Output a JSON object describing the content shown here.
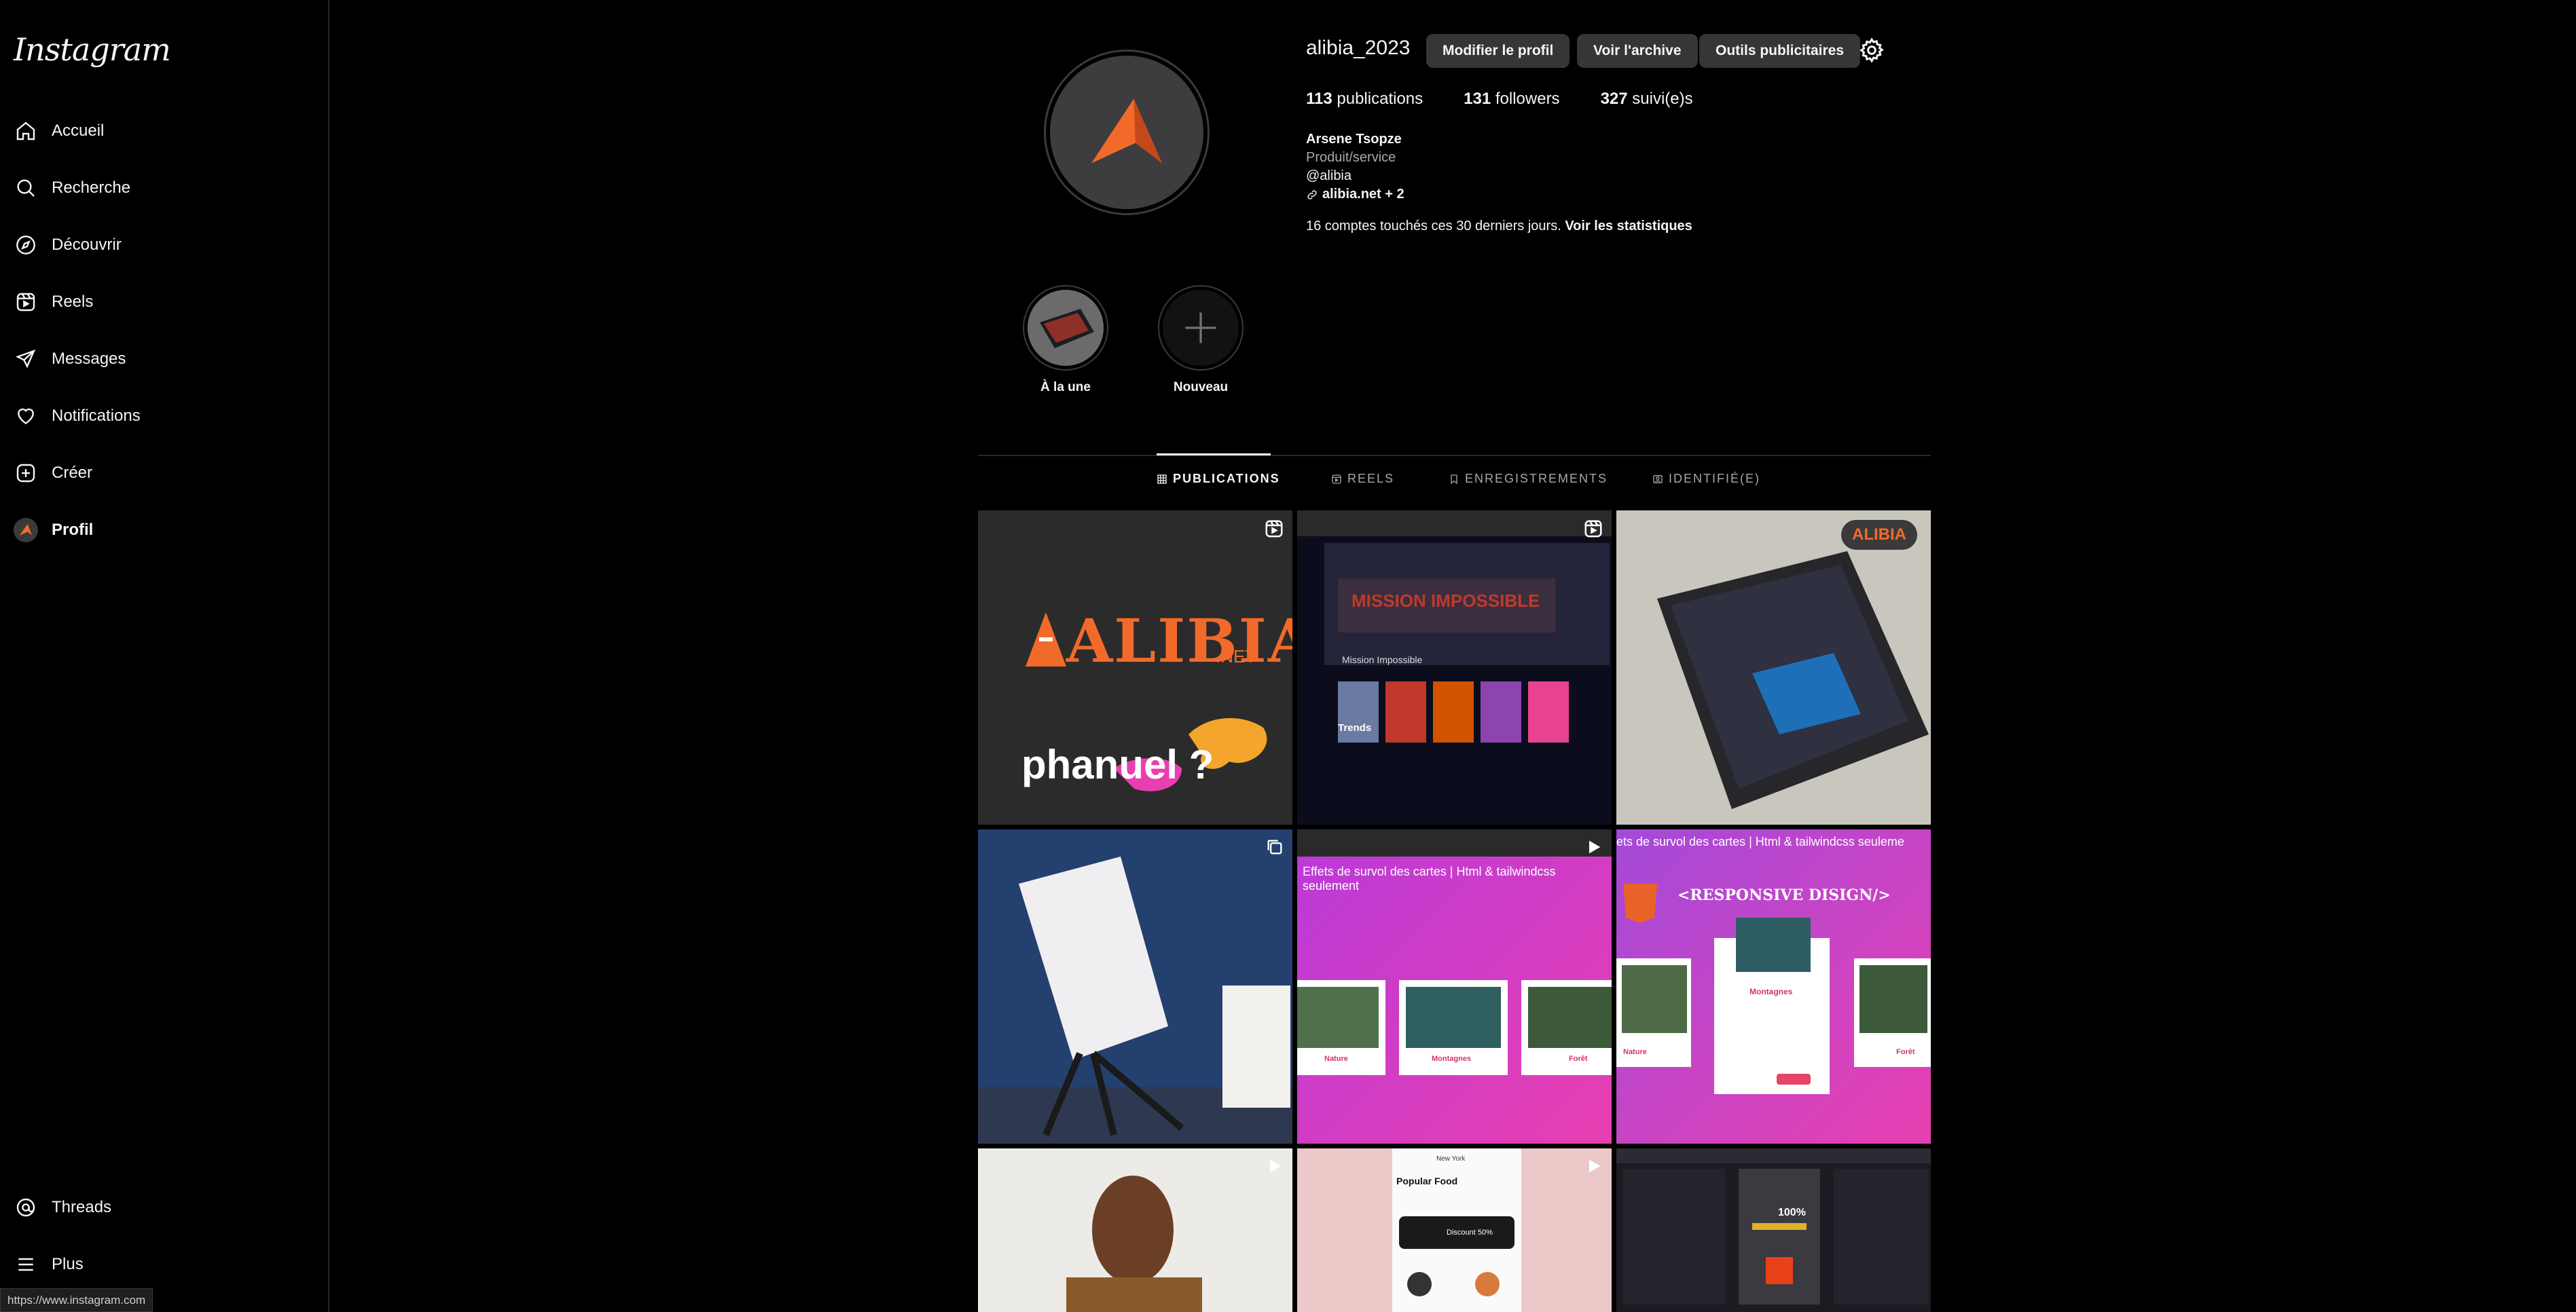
{
  "sidebar": {
    "logo": "Instagram",
    "items": [
      {
        "label": "Accueil",
        "icon": "home-icon"
      },
      {
        "label": "Recherche",
        "icon": "search-icon"
      },
      {
        "label": "Découvrir",
        "icon": "compass-icon"
      },
      {
        "label": "Reels",
        "icon": "reels-icon"
      },
      {
        "label": "Messages",
        "icon": "send-icon"
      },
      {
        "label": "Notifications",
        "icon": "heart-icon"
      },
      {
        "label": "Créer",
        "icon": "plus-square-icon"
      },
      {
        "label": "Profil",
        "icon": "avatar"
      }
    ],
    "bottom": [
      {
        "label": "Threads",
        "icon": "threads-icon"
      },
      {
        "label": "Plus",
        "icon": "menu-icon"
      }
    ]
  },
  "status_url": "https://www.instagram.com",
  "profile": {
    "username": "alibia_2023",
    "buttons": {
      "edit": "Modifier le profil",
      "archive": "Voir l'archive",
      "ads": "Outils publicitaires"
    },
    "stats": {
      "posts_count": "113",
      "posts_label": "publications",
      "followers_count": "131",
      "followers_label": "followers",
      "following_count": "327",
      "following_label": "suivi(e)s"
    },
    "bio": {
      "name": "Arsene Tsopze",
      "category": "Produit/service",
      "handle": "@alibia",
      "link": "alibia.net + 2"
    },
    "reach_text": "16 comptes touchés ces 30 derniers jours.",
    "reach_link": "Voir les statistiques"
  },
  "highlights": [
    {
      "label": "À la une"
    },
    {
      "label": "Nouveau"
    }
  ],
  "tabs": [
    {
      "label": "PUBLICATIONS",
      "icon": "grid-icon"
    },
    {
      "label": "REELS",
      "icon": "reels-icon"
    },
    {
      "label": "ENREGISTREMENTS",
      "icon": "bookmark-icon"
    },
    {
      "label": "IDENTIFIÉ(E)",
      "icon": "tagged-icon"
    }
  ],
  "posts": [
    {
      "type": "reel",
      "brand": "ALIBIA",
      "brand_suffix": ".NET",
      "word": "phanuel ?"
    },
    {
      "type": "reel",
      "brand": "MISSION IMPOSSIBLE",
      "sub": "Mission Impossible",
      "trends": "Trends"
    },
    {
      "type": "carousel",
      "tag": "ALIBIA"
    },
    {
      "type": "carousel"
    },
    {
      "type": "reel",
      "caption": "Effets de survol des cartes | Html & tailwindcss seulement",
      "cards": [
        "Nature",
        "Montagnes",
        "Forêt"
      ]
    },
    {
      "type": "image",
      "caption": "ets de survol des cartes | Html & tailwindcss seuleme",
      "title": "<RESPONSIVE DISIGN/>",
      "cards": [
        "Nature",
        "Montagnes",
        "Forêt"
      ]
    },
    {
      "type": "reel"
    },
    {
      "type": "reel",
      "place": "New York",
      "title": "Popular Food",
      "promo": "Discount 50%"
    },
    {
      "type": "image",
      "percent": "100%"
    }
  ],
  "colors": {
    "accent_orange": "#f26a2a",
    "pink": "#d63fc2",
    "magenta": "#c02cb3"
  }
}
